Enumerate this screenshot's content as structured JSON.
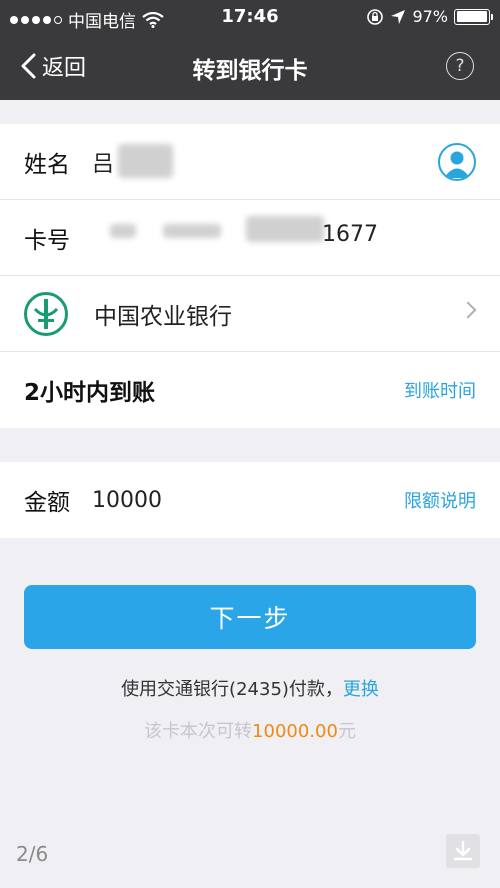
{
  "status_bar": {
    "carrier": "中国电信",
    "time": "17:46",
    "battery": "97%",
    "battery_level": 0.97
  },
  "nav": {
    "back_label": "返回",
    "title": "转到银行卡",
    "help_symbol": "?"
  },
  "form": {
    "name_label": "姓名",
    "name_value": "吕",
    "card_label": "卡号",
    "card_value_suffix": "1677",
    "bank_name": "中国农业银行",
    "arrival_text": "2小时内到账",
    "arrival_link": "到账时间",
    "amount_label": "金额",
    "amount_value": "10000",
    "limit_link": "限额说明"
  },
  "actions": {
    "next_button": "下一步",
    "pay_text": "使用交通银行(2435)付款，",
    "change_link": "更换",
    "limit_prefix": "该卡本次可转",
    "limit_amount": "10000.00",
    "limit_unit": "元"
  },
  "pager": "2/6",
  "colors": {
    "accent": "#29a5dd",
    "button": "#29a5e8",
    "amount": "#f08a16",
    "bank_green": "#1a9a73"
  },
  "icons": [
    "wifi-icon",
    "lock-rotation-icon",
    "location-arrow-icon",
    "battery-icon",
    "back-chevron-icon",
    "help-icon",
    "contact-icon",
    "abc-bank-logo-icon",
    "chevron-right-icon",
    "download-icon"
  ]
}
